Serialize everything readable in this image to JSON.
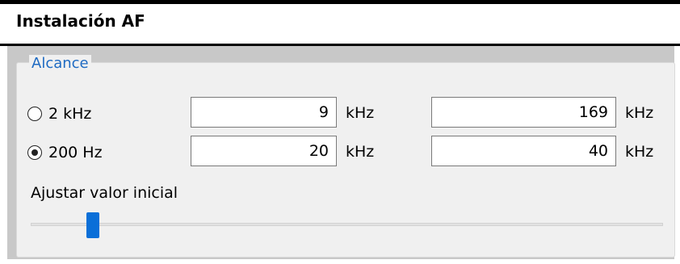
{
  "title": "Instalación AF",
  "group": {
    "title": "Alcance",
    "accent_color": "#1e6ac2",
    "rows": [
      {
        "radio_label": "2 kHz",
        "selected": false,
        "value1": "9",
        "unit1": "kHz",
        "value2": "169",
        "unit2": "kHz"
      },
      {
        "radio_label": "200 Hz",
        "selected": true,
        "value1": "20",
        "unit1": "kHz",
        "value2": "40",
        "unit2": "kHz"
      }
    ]
  },
  "slider": {
    "label": "Ajustar valor inicial",
    "value_fraction": 0.09,
    "thumb_color": "#0a6fd8"
  }
}
